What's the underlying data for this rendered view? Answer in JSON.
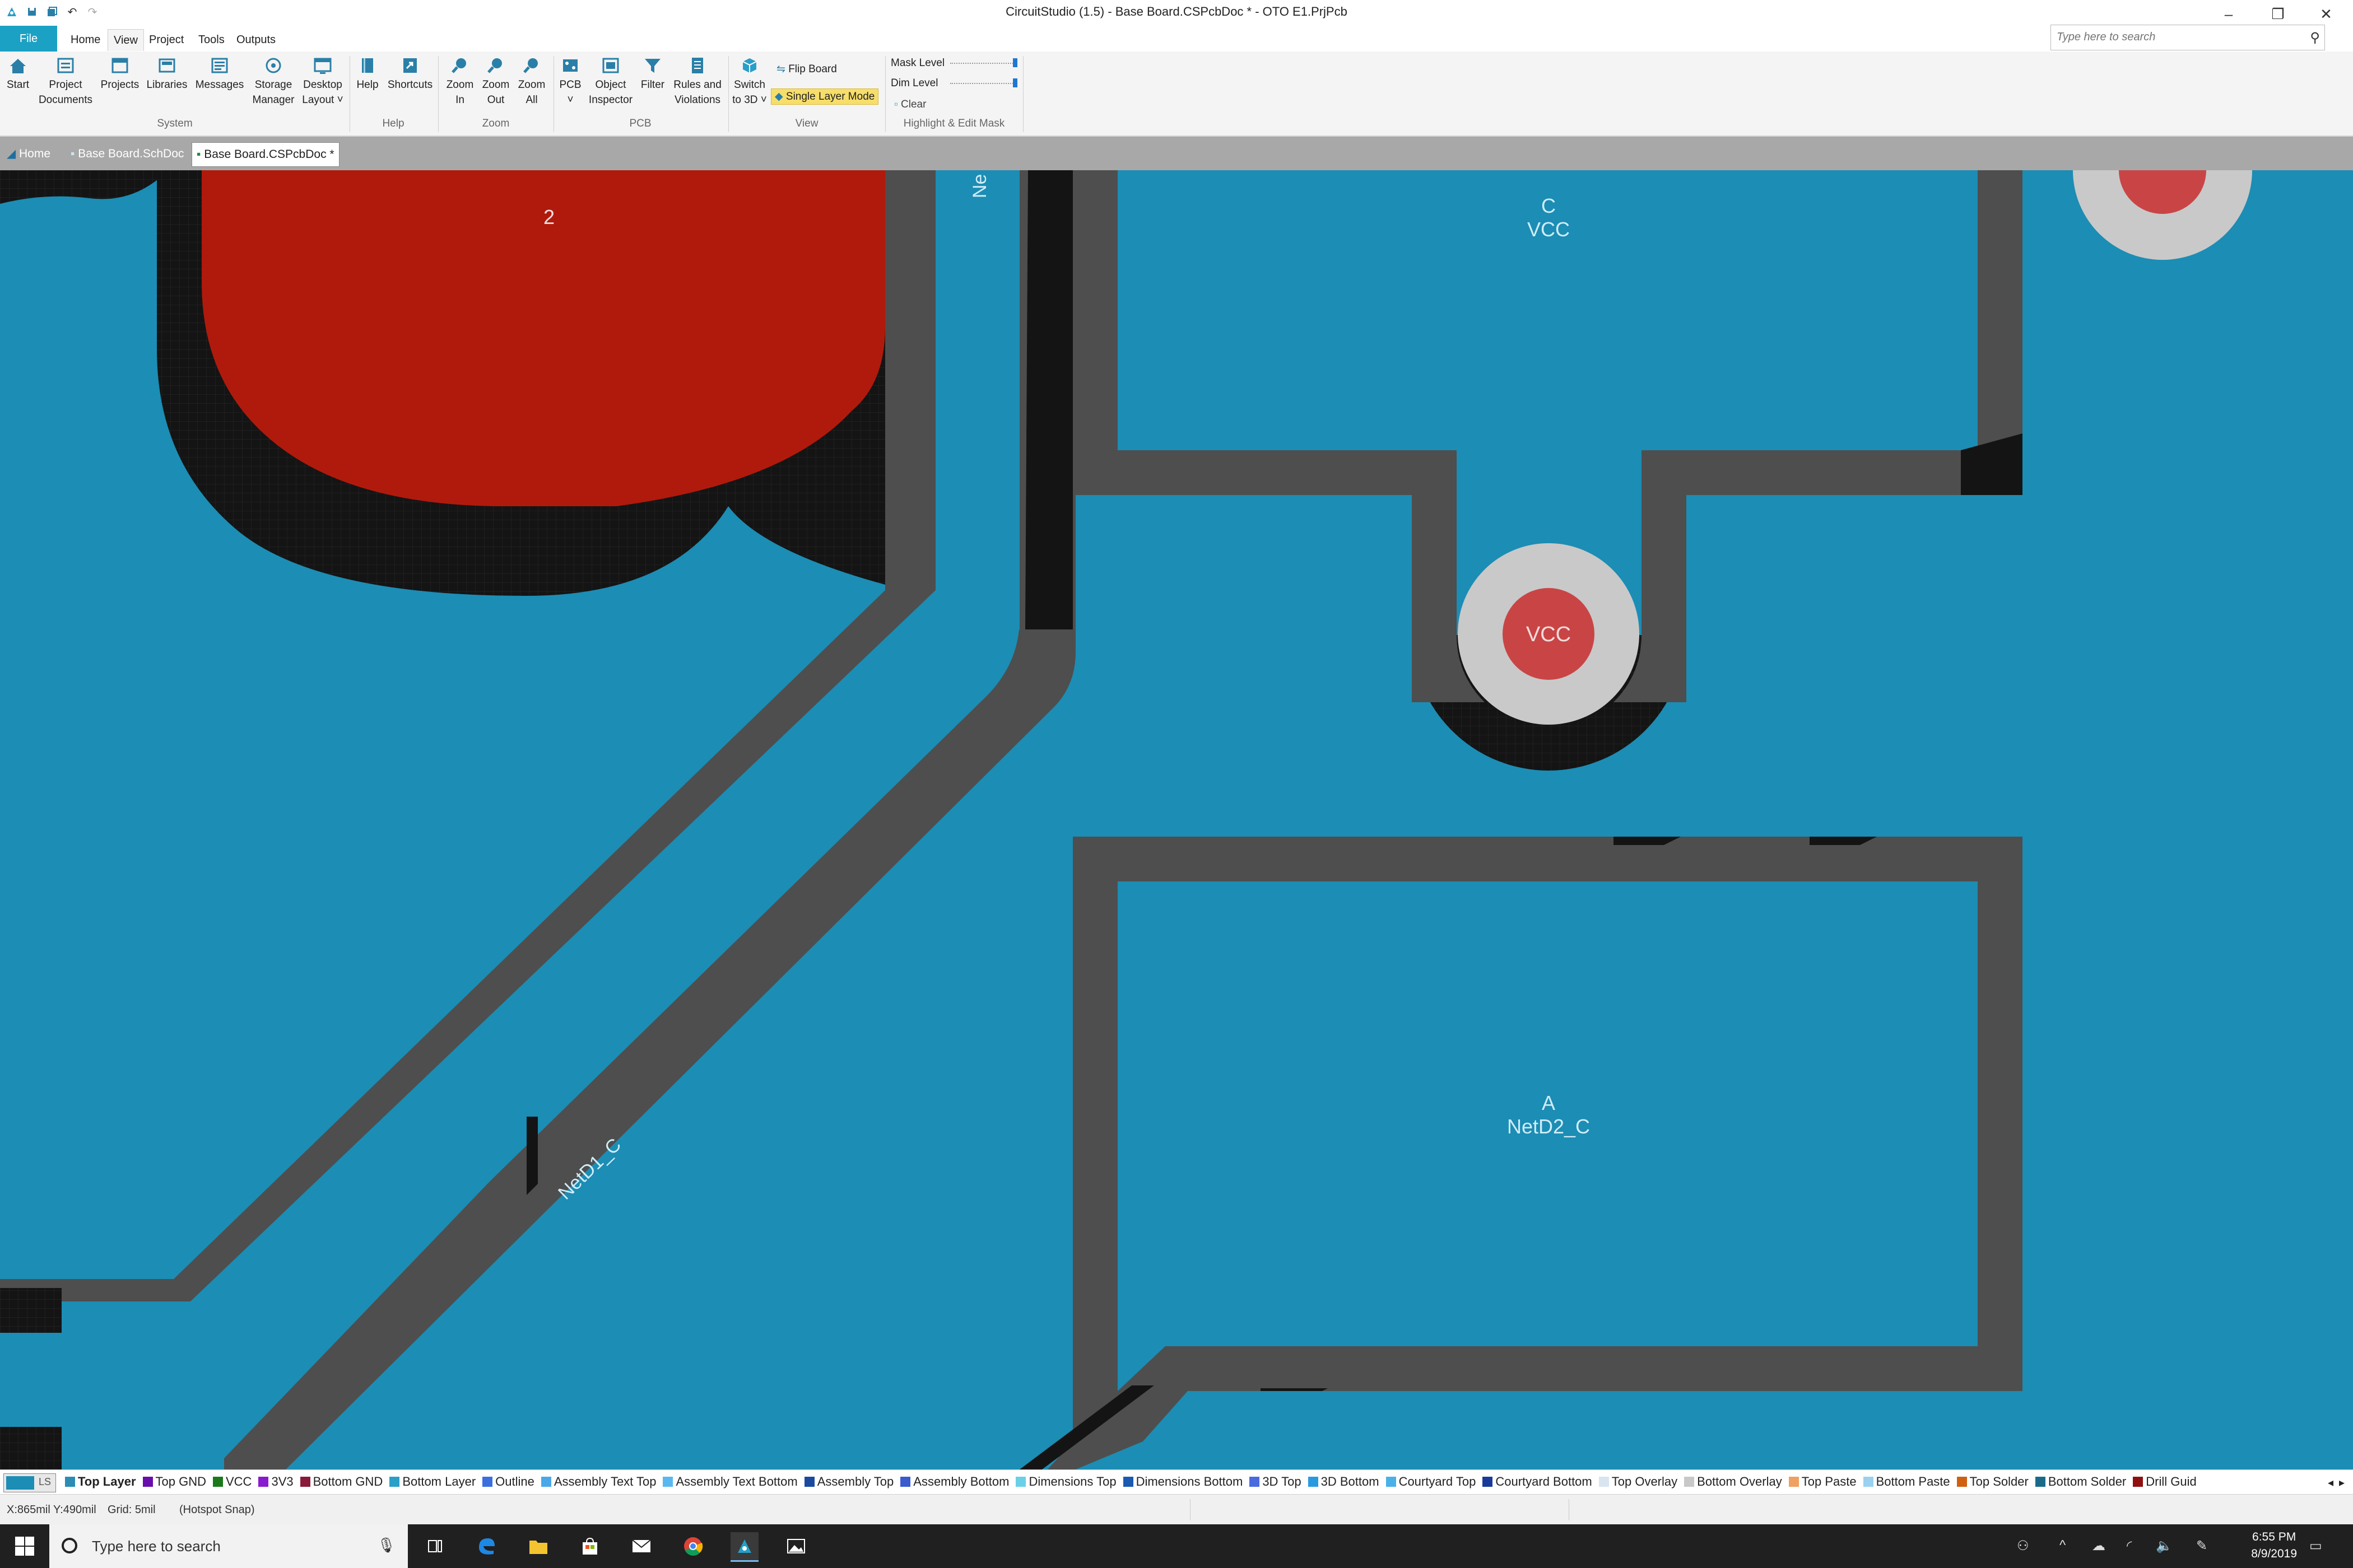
{
  "titlebar": {
    "title": "CircuitStudio (1.5) - Base Board.CSPcbDoc * - OTO E1.PrjPcb",
    "quick_access_icons": [
      "app-logo-icon",
      "save-icon",
      "save-all-icon",
      "undo-icon",
      "redo-icon"
    ],
    "window_controls": [
      "minimize-icon",
      "restore-icon",
      "close-icon"
    ]
  },
  "ribbon_tabs": {
    "file": "File",
    "items": [
      "Home",
      "View",
      "Project",
      "Tools",
      "Outputs"
    ],
    "active": "View"
  },
  "search": {
    "placeholder": "Type here to search"
  },
  "ribbon": {
    "system": {
      "label": "System",
      "start": "Start",
      "project_documents": [
        "Project",
        "Documents"
      ],
      "projects": "Projects",
      "libraries": "Libraries",
      "messages": "Messages",
      "storage_manager": [
        "Storage",
        "Manager"
      ],
      "desktop_layout": [
        "Desktop",
        "Layout ˅"
      ]
    },
    "help": {
      "label": "Help",
      "help": "Help",
      "shortcuts": "Shortcuts"
    },
    "zoom": {
      "label": "Zoom",
      "zoom_in": [
        "Zoom",
        "In"
      ],
      "zoom_out": [
        "Zoom",
        "Out"
      ],
      "zoom_all": [
        "Zoom",
        "All"
      ]
    },
    "pcb": {
      "label": "PCB",
      "pcb": [
        "PCB",
        "˅"
      ],
      "object_inspector": [
        "Object",
        "Inspector"
      ],
      "filter": "Filter",
      "rules": [
        "Rules and",
        "Violations"
      ]
    },
    "view": {
      "label": "View",
      "switch_3d": [
        "Switch",
        "to 3D ˅"
      ],
      "flip_board": "Flip Board",
      "single_layer_mode": "Single Layer Mode"
    },
    "mask": {
      "label": "Highlight & Edit Mask",
      "mask_level": "Mask Level",
      "dim_level": "Dim Level",
      "clear": "Clear"
    }
  },
  "doc_tabs": [
    {
      "label": "Home"
    },
    {
      "label": "Base Board.SchDoc"
    },
    {
      "label": "Base Board.CSPcbDoc *"
    }
  ],
  "pcb_canvas": {
    "colors": {
      "board": "#1c8db4",
      "clearance": "#4e4e4e",
      "void": "#141414",
      "top_pad": "#b01a0c",
      "via_pad": "#c9c9c9",
      "via_hole": "#c94545",
      "text": "#d0ecf8"
    },
    "labels": {
      "pad_number": "2",
      "net_partial": "Ne",
      "pad_c_designator": "C",
      "pad_c_net": "VCC",
      "via_net": "VCC",
      "trace_net": "NetD1_C",
      "pad_a_designator": "A",
      "pad_a_net": "NetD2_C"
    }
  },
  "layer_tabs": {
    "ls_label": "LS",
    "layers": [
      {
        "name": "Top Layer",
        "color": "#2b8cb4",
        "active": true
      },
      {
        "name": "Top GND",
        "color": "#6a0dad"
      },
      {
        "name": "VCC",
        "color": "#1a7a1a"
      },
      {
        "name": "3V3",
        "color": "#8a1ad0"
      },
      {
        "name": "Bottom GND",
        "color": "#8a1a3a"
      },
      {
        "name": "Bottom Layer",
        "color": "#2aa0c8"
      },
      {
        "name": "Outline",
        "color": "#3b6fe0"
      },
      {
        "name": "Assembly Text Top",
        "color": "#4aa8e8"
      },
      {
        "name": "Assembly Text Bottom",
        "color": "#5ab8f0"
      },
      {
        "name": "Assembly Top",
        "color": "#1a4aa0"
      },
      {
        "name": "Assembly Bottom",
        "color": "#3a5ad0"
      },
      {
        "name": "Dimensions Top",
        "color": "#6ad0e8"
      },
      {
        "name": "Dimensions Bottom",
        "color": "#1a5ab0"
      },
      {
        "name": "3D Top",
        "color": "#4a6ae0"
      },
      {
        "name": "3D Bottom",
        "color": "#2a9ae0"
      },
      {
        "name": "Courtyard Top",
        "color": "#4ab0e8"
      },
      {
        "name": "Courtyard Bottom",
        "color": "#1a3a9a"
      },
      {
        "name": "Top Overlay",
        "color": "#d8e4f0"
      },
      {
        "name": "Bottom Overlay",
        "color": "#c8c8c8"
      },
      {
        "name": "Top Paste",
        "color": "#f0a060"
      },
      {
        "name": "Bottom Paste",
        "color": "#9ad0f0"
      },
      {
        "name": "Top Solder",
        "color": "#d06010"
      },
      {
        "name": "Bottom Solder",
        "color": "#1a6a8a"
      },
      {
        "name": "Drill Guid",
        "color": "#901010"
      }
    ]
  },
  "status": {
    "coords": "X:865mil Y:490mil",
    "grid": "Grid: 5mil",
    "snap": "(Hotspot Snap)"
  },
  "taskbar": {
    "search_placeholder": "Type here to search",
    "time": "6:55 PM",
    "date": "8/9/2019"
  }
}
